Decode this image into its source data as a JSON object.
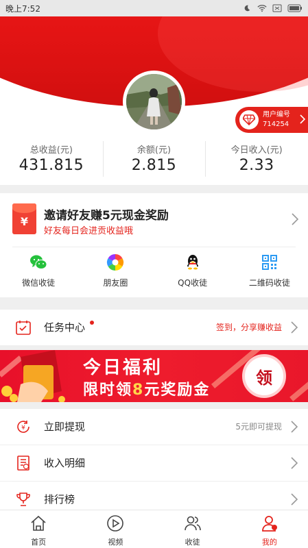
{
  "status_bar": {
    "time": "晚上7:52"
  },
  "profile": {
    "user_id_label": "用户编号",
    "user_id_value": "714254"
  },
  "stats": [
    {
      "label": "总收益(元)",
      "value": "431.815"
    },
    {
      "label": "余额(元)",
      "value": "2.815"
    },
    {
      "label": "今日收入(元)",
      "value": "2.33"
    }
  ],
  "invite": {
    "icon_text": "¥",
    "title": "邀请好友赚5元现金奖励",
    "subtitle": "好友每日会进贡收益哦",
    "share_options": [
      {
        "label": "微信收徒",
        "icon": "wechat-icon"
      },
      {
        "label": "朋友圈",
        "icon": "moments-icon"
      },
      {
        "label": "QQ收徒",
        "icon": "qq-icon"
      },
      {
        "label": "二维码收徒",
        "icon": "qrcode-icon"
      }
    ]
  },
  "task_center": {
    "title": "任务中心",
    "right_text": "签到，分享赚收益"
  },
  "banner": {
    "line1": "今日福利",
    "line2_prefix": "限时领",
    "line2_highlight": "8",
    "line2_suffix": "元奖励金",
    "badge": "领"
  },
  "menu": [
    {
      "title": "立即提现",
      "right_text": "5元即可提现",
      "icon": "withdraw-icon"
    },
    {
      "title": "收入明细",
      "right_text": "",
      "icon": "income-detail-icon"
    },
    {
      "title": "排行榜",
      "right_text": "",
      "icon": "trophy-icon"
    }
  ],
  "tabs": [
    {
      "label": "首页",
      "icon": "home-icon"
    },
    {
      "label": "视频",
      "icon": "video-icon"
    },
    {
      "label": "收徒",
      "icon": "apprentice-icon"
    },
    {
      "label": "我的",
      "icon": "profile-icon",
      "active": true
    }
  ],
  "colors": {
    "brand_red": "#e4231c",
    "banner_red": "#ee1c2d",
    "highlight_yellow": "#ffd84a"
  }
}
